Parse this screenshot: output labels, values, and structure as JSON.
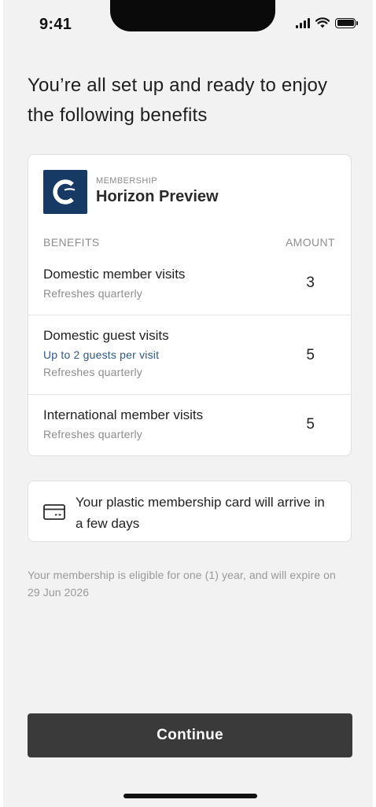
{
  "status_bar": {
    "time": "9:41",
    "icons": [
      "cellular-signal-icon",
      "wifi-icon",
      "battery-icon"
    ]
  },
  "headline": "You’re all set up and ready to enjoy the following benefits",
  "membership": {
    "eyebrow": "MEMBERSHIP",
    "name": "Horizon Preview",
    "logo_icon": "horizon-logo-icon",
    "logo_color": "#163a63"
  },
  "benefits": {
    "header_left": "BENEFITS",
    "header_right": "AMOUNT",
    "rows": [
      {
        "title": "Domestic member visits",
        "highlight": "",
        "note": "Refreshes quarterly",
        "amount": "3"
      },
      {
        "title": "Domestic guest visits",
        "highlight": "Up to 2 guests per visit",
        "note": "Refreshes quarterly",
        "amount": "5"
      },
      {
        "title": "International member visits",
        "highlight": "",
        "note": "Refreshes quarterly",
        "amount": "5"
      }
    ]
  },
  "card_notice": {
    "icon": "credit-card-icon",
    "text": "Your plastic membership card will arrive in a few days"
  },
  "footnote": "Your membership is eligible for one (1) year, and will expire on 29 Jun 2026",
  "continue_label": "Continue",
  "colors": {
    "background": "#f2f2f2",
    "button": "#3a3a3a",
    "highlight_text": "#2c5a8a"
  }
}
